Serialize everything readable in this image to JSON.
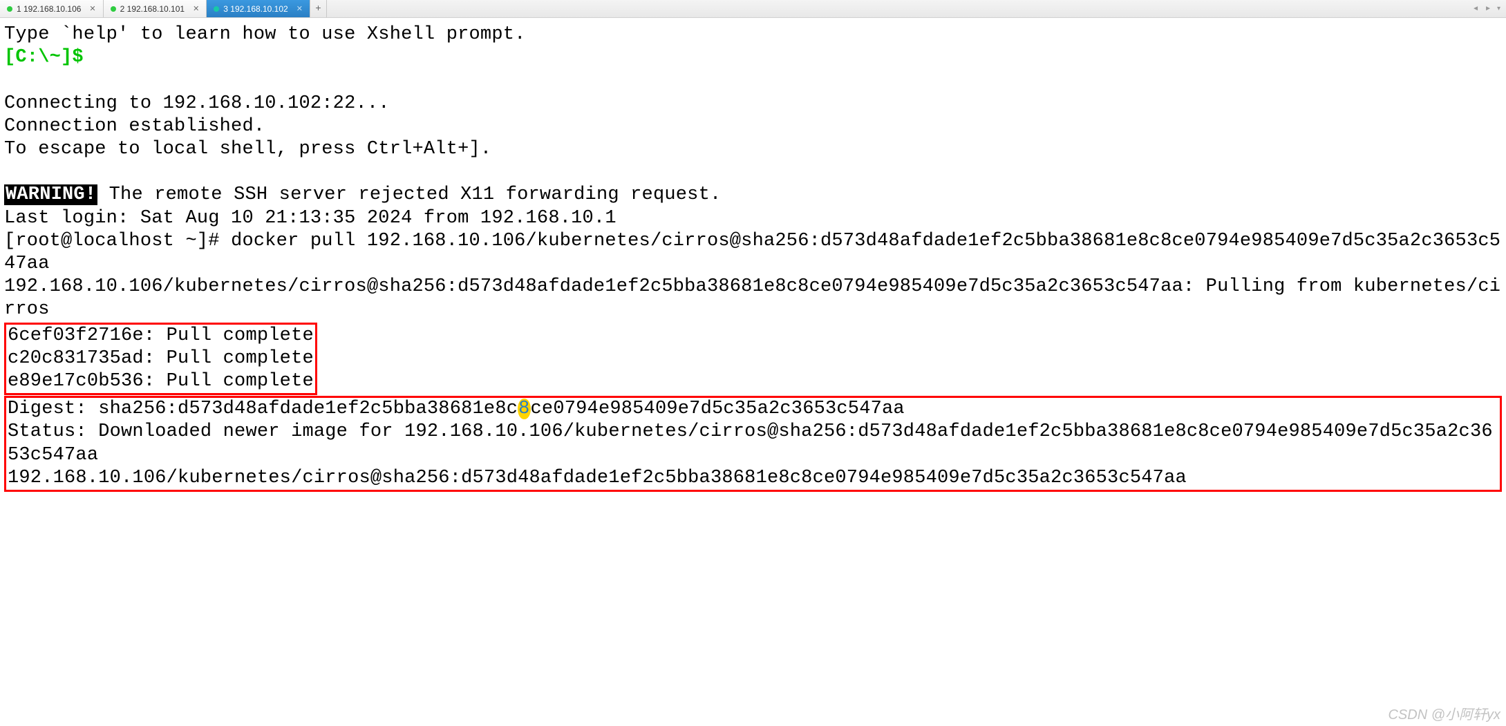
{
  "tabs": [
    {
      "label": "1 192.168.10.106",
      "active": false,
      "dot": "green"
    },
    {
      "label": "2 192.168.10.101",
      "active": false,
      "dot": "green"
    },
    {
      "label": "3 192.168.10.102",
      "active": true,
      "dot": "teal"
    }
  ],
  "newTabGlyph": "+",
  "nav": {
    "left": "◄",
    "right": "►",
    "menu": "▾"
  },
  "term": {
    "helpLine": "Type `help' to learn how to use Xshell prompt.",
    "localPrompt": "[C:\\~]$ ",
    "connecting": "Connecting to 192.168.10.102:22...",
    "established": "Connection established.",
    "escape": "To escape to local shell, press Ctrl+Alt+].",
    "warnLabel": "WARNING!",
    "warnText": " The remote SSH server rejected X11 forwarding request.",
    "lastLogin": "Last login: Sat Aug 10 21:13:35 2024 from 192.168.10.1",
    "shellPrompt": "[root@localhost ~]# ",
    "command": "docker pull 192.168.10.106/kubernetes/cirros@sha256:d573d48afdade1ef2c5bba38681e8c8ce0794e985409e7d5c35a2c3653c547aa",
    "pullingLine": "192.168.10.106/kubernetes/cirros@sha256:d573d48afdade1ef2c5bba38681e8c8ce0794e985409e7d5c35a2c3653c547aa: Pulling from kubernetes/cirros",
    "layers": [
      "6cef03f2716e: Pull complete",
      "c20c831735ad: Pull complete",
      "e89e17c0b536: Pull complete"
    ],
    "digestPrefix": "Digest: sha256:d573d48afdade1ef2c5bba38681e8c",
    "digestHl": "8",
    "digestSuffix": "ce0794e985409e7d5c35a2c3653c547aa",
    "status": "Status: Downloaded newer image for 192.168.10.106/kubernetes/cirros@sha256:d573d48afdade1ef2c5bba38681e8c8ce0794e985409e7d5c35a2c3653c547aa",
    "finalRef": "192.168.10.106/kubernetes/cirros@sha256:d573d48afdade1ef2c5bba38681e8c8ce0794e985409e7d5c35a2c3653c547aa"
  },
  "watermark": "CSDN @小阿轩yx"
}
